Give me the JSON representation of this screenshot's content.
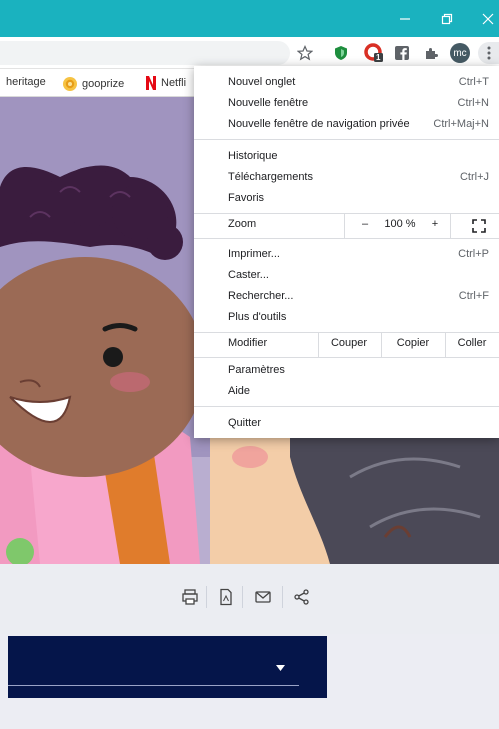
{
  "window": {
    "minimize_icon": "minimize-icon",
    "restore_icon": "restore-icon",
    "close_icon": "close-icon"
  },
  "toolbar": {
    "avatar_initials": "mc",
    "extension_badge": "1"
  },
  "bookmarks": [
    {
      "label": "heritage"
    },
    {
      "label": "gooprize"
    },
    {
      "label": "Netfli"
    }
  ],
  "menu": {
    "new_tab": {
      "label": "Nouvel onglet",
      "shortcut": "Ctrl+T"
    },
    "new_window": {
      "label": "Nouvelle fenêtre",
      "shortcut": "Ctrl+N"
    },
    "incognito": {
      "label": "Nouvelle fenêtre de navigation privée",
      "shortcut": "Ctrl+Maj+N"
    },
    "history": {
      "label": "Historique"
    },
    "downloads": {
      "label": "Téléchargements",
      "shortcut": "Ctrl+J"
    },
    "favorites": {
      "label": "Favoris"
    },
    "zoom": {
      "label": "Zoom",
      "minus": "–",
      "value": "100 %",
      "plus": "+"
    },
    "print": {
      "label": "Imprimer...",
      "shortcut": "Ctrl+P"
    },
    "cast": {
      "label": "Caster..."
    },
    "find": {
      "label": "Rechercher...",
      "shortcut": "Ctrl+F"
    },
    "more_tools": {
      "label": "Plus d'outils"
    },
    "edit": {
      "label": "Modifier",
      "cut": "Couper",
      "copy": "Copier",
      "paste": "Coller"
    },
    "settings": {
      "label": "Paramètres"
    },
    "help": {
      "label": "Aide"
    },
    "quit": {
      "label": "Quitter"
    }
  },
  "page_actions": [
    "print-icon",
    "pdf-icon",
    "email-icon",
    "share-icon"
  ],
  "colors": {
    "titlebar": "#1ab2bf",
    "dark_panel": "#05154a",
    "illustration_bg": "#a094bf"
  }
}
